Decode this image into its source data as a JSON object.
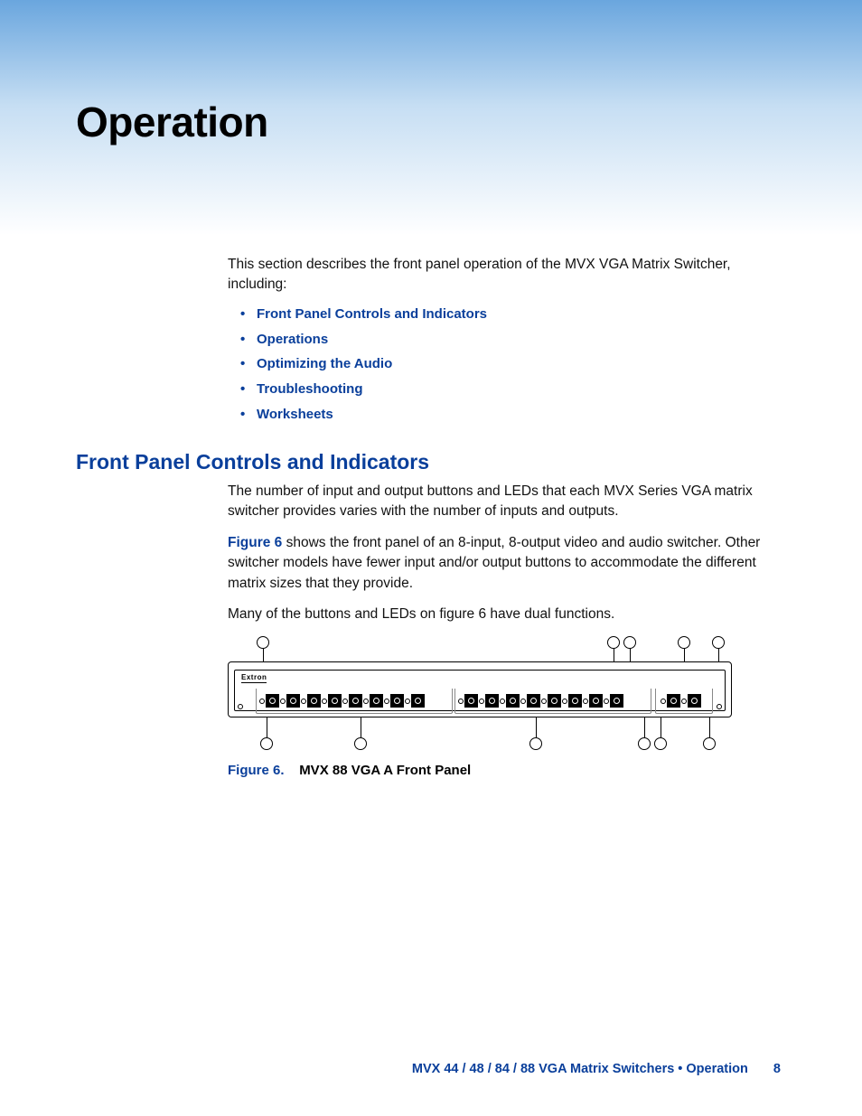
{
  "title": "Operation",
  "intro": "This section describes the front panel operation of the MVX VGA Matrix Switcher, including:",
  "links": [
    "Front Panel Controls and Indicators",
    "Operations",
    "Optimizing the Audio",
    "Troubleshooting",
    "Worksheets"
  ],
  "section_heading": "Front Panel Controls and Indicators",
  "para1": "The number of input and output buttons and LEDs that each MVX Series VGA matrix switcher provides varies with the number of inputs and outputs.",
  "para2_prefix": "Figure 6",
  "para2_rest": " shows the front panel of an 8-input, 8-output video and audio switcher. Other switcher models have fewer input and/or output buttons to accommodate the different matrix sizes that they provide.",
  "para3": "Many of the buttons and LEDs on figure 6 have dual functions.",
  "panel_brand": "Extron",
  "figure_label": "Figure 6.",
  "figure_text": "MVX 88 VGA A Front Panel",
  "footer_text": "MVX 44 / 48 / 84 / 88 VGA Matrix Switchers • Operation",
  "page_number": "8"
}
